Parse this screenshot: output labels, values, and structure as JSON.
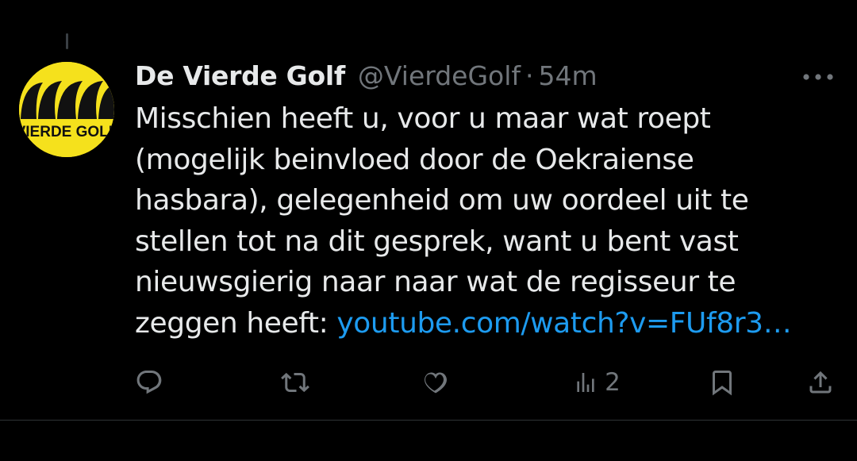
{
  "tweet": {
    "display_name": "De Vierde Golf",
    "handle": "@VierdeGolf",
    "separator": "·",
    "time": "54m",
    "avatar_text": "VIERDE GOLF",
    "text_lines": [
      "Misschien heeft u, voor u maar wat roept",
      "(mogelijk beinvloed door de Oekraiense",
      "hasbara), gelegenheid om uw oordeel uit te",
      "stellen tot na dit gesprek, want u bent vast",
      "nieuwsgierig naar naar wat de regisseur te"
    ],
    "last_line_prefix": "zeggen heeft: ",
    "link_text": "youtube.com/watch?v=FUf8r3…"
  },
  "actions": {
    "reply_icon": "reply-icon",
    "retweet_icon": "retweet-icon",
    "like_icon": "heart-icon",
    "views_icon": "views-icon",
    "views_count": "2",
    "bookmark_icon": "bookmark-icon",
    "share_icon": "share-icon"
  },
  "colors": {
    "background": "#000000",
    "text": "#e7e9ea",
    "muted": "#71767b",
    "link": "#1d9bf0",
    "avatar_yellow": "#f5e11c"
  }
}
